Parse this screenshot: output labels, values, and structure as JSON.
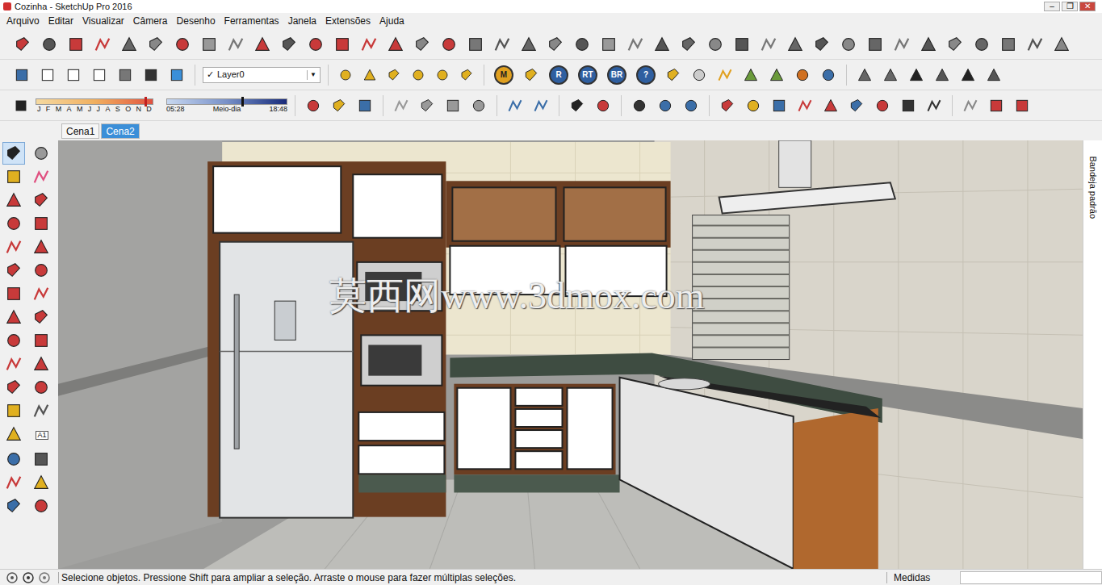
{
  "window": {
    "title": "Cozinha - SketchUp Pro 2016",
    "controls": [
      "–",
      "❐",
      "✕"
    ]
  },
  "menu": [
    "Arquivo",
    "Editar",
    "Visualizar",
    "Câmera",
    "Desenho",
    "Ferramentas",
    "Janela",
    "Extensões",
    "Ajuda"
  ],
  "layer": {
    "check": "✓",
    "value": "Layer0",
    "arrow": "▼"
  },
  "shadow": {
    "months": [
      "J",
      "F",
      "M",
      "A",
      "M",
      "J",
      "J",
      "A",
      "S",
      "O",
      "N",
      "D"
    ],
    "date_level": 0.93,
    "time_level": 0.62,
    "time_start": "05:28",
    "time_mid": "Meio-dia",
    "time_end": "18:48"
  },
  "badges": [
    {
      "label": "M",
      "color": "#e0a020"
    },
    {
      "label": "R",
      "color": "#2f5fa0"
    },
    {
      "label": "RT",
      "color": "#2f5fa0"
    },
    {
      "label": "BR",
      "color": "#2f5fa0"
    },
    {
      "label": "?",
      "color": "#2f5fa0"
    }
  ],
  "scenes": [
    {
      "label": "Cena1",
      "selected": false
    },
    {
      "label": "Cena2",
      "selected": true
    }
  ],
  "text_tool_label": "A1",
  "tray": {
    "label": "Bandeja padrão"
  },
  "watermark": "莫西网www.3dmox.com",
  "status_bar": {
    "message": "Selecione objetos. Pressione Shift para ampliar a seleção. Arraste o mouse para fazer múltiplas seleções.",
    "measurements": "Medidas"
  }
}
